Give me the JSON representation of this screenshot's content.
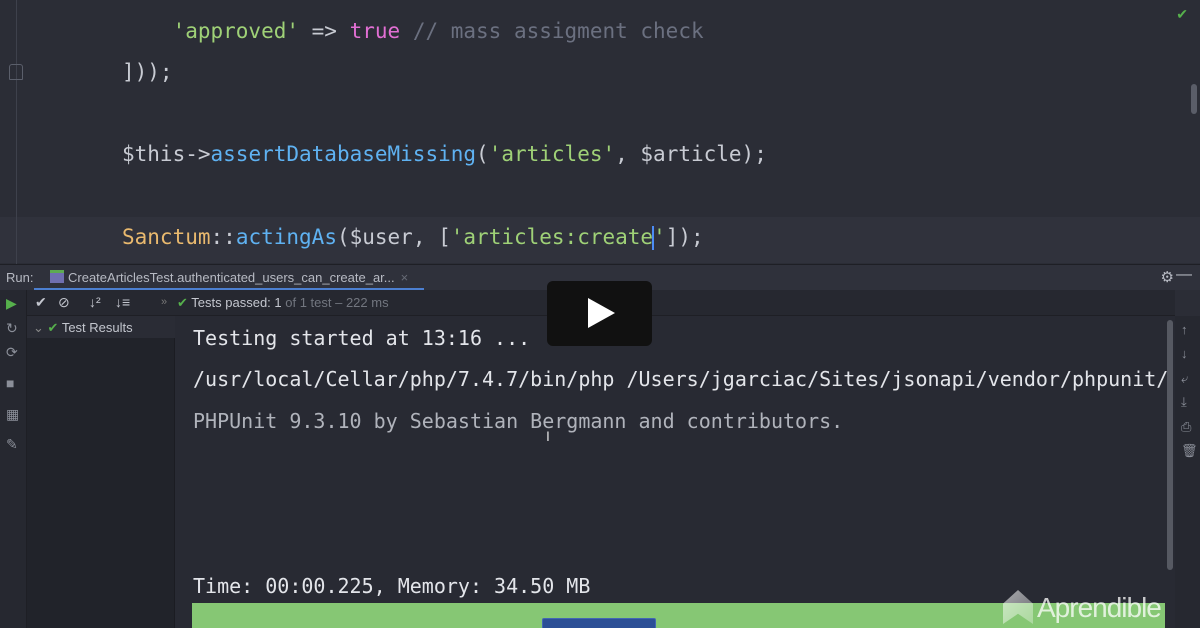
{
  "editor": {
    "lines": [
      {
        "indent": "    ",
        "str": "'approved'",
        "op": " => ",
        "kw": "true",
        "comment": " // mass assigment check"
      },
      {
        "text": "]));"
      },
      {
        "var": "$this->",
        "fn": "assertDatabaseMissing",
        "open": "(",
        "str": "'articles'",
        "rest": ", $article);"
      },
      {
        "cls": "Sanctum",
        "sep": "::",
        "fn": "actingAs",
        "mid": "($user, [",
        "str1": "'articles:create",
        "str2": "'",
        "end": "]);"
      }
    ]
  },
  "run": {
    "label": "Run:",
    "tab_label": "CreateArticlesTest.authenticated_users_can_create_ar...",
    "tab_close": "×",
    "settings_icon": "⚙",
    "minimize_icon": "—"
  },
  "toolbar": {
    "status_prefix": "Tests passed: 1",
    "status_suffix": " of 1 test – 222 ms"
  },
  "tree": {
    "root": "Test Results"
  },
  "console": {
    "lines": [
      "Testing started at 13:16 ...",
      "/usr/local/Cellar/php/7.4.7/bin/php /Users/jgarciac/Sites/jsonapi/vendor/phpunit/",
      "PHPUnit 9.3.10 by Sebastian Bergmann and contributors.",
      "Time: 00:00.225, Memory: 34.50 MB"
    ]
  },
  "watermark": "Aprendible",
  "colors": {
    "success": "#56b04c",
    "string": "#9fd177",
    "keyword": "#e26fd4",
    "function": "#5fb2f2",
    "class": "#e9b96e"
  }
}
